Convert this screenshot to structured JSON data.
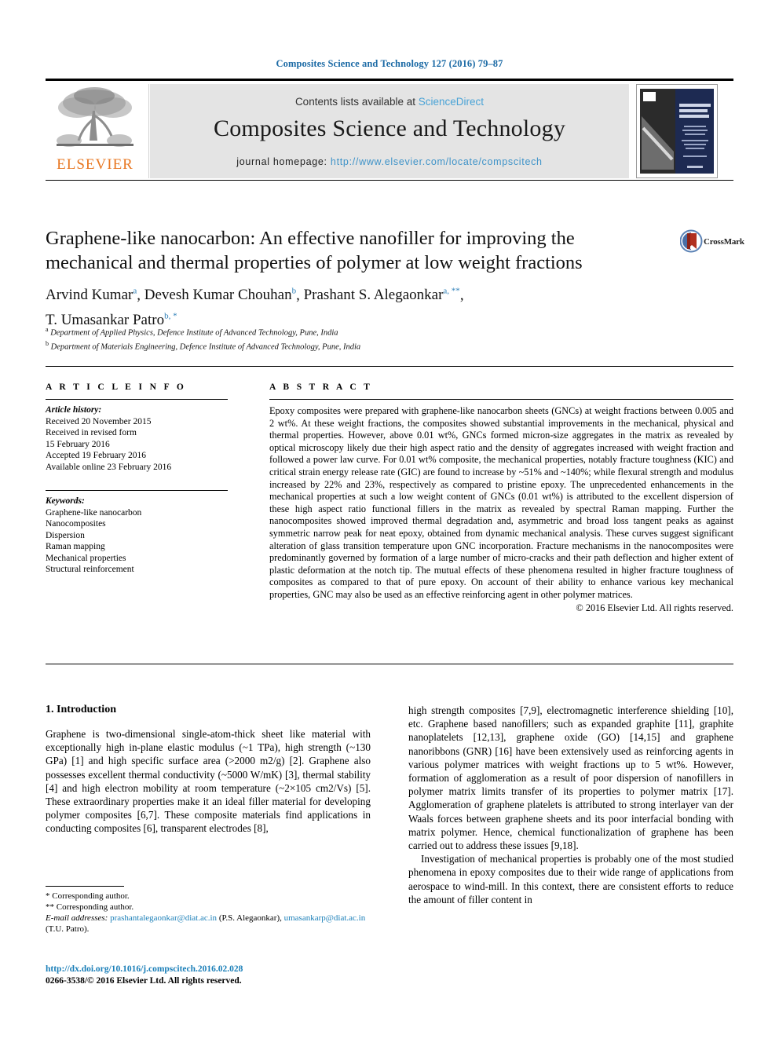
{
  "running_head": "Composites Science and Technology 127 (2016) 79–87",
  "masthead": {
    "publisher_name": "ELSEVIER",
    "contents_prefix": "Contents lists available at ",
    "contents_link": "ScienceDirect",
    "journal_title": "Composites Science and Technology",
    "homepage_label": "journal homepage:",
    "homepage_url": "http://www.elsevier.com/locate/compscitech",
    "cover_title": "COMPOSITES SCIENCE AND TECHNOLOGY"
  },
  "article": {
    "title": "Graphene-like nanocarbon: An effective nanofiller for improving the mechanical and thermal properties of polymer at low weight fractions",
    "crossmark_label": "CrossMark",
    "authors": [
      {
        "name": "Arvind Kumar",
        "marks": "a"
      },
      {
        "name": "Devesh Kumar Chouhan",
        "marks": "b"
      },
      {
        "name": "Prashant S. Alegaonkar",
        "marks": "a, **"
      },
      {
        "name": "T. Umasankar Patro",
        "marks": "b, *"
      }
    ],
    "affiliations": [
      {
        "mark": "a",
        "text": "Department of Applied Physics, Defence Institute of Advanced Technology, Pune, India"
      },
      {
        "mark": "b",
        "text": "Department of Materials Engineering, Defence Institute of Advanced Technology, Pune, India"
      }
    ]
  },
  "article_info": {
    "heading": "A R T I C L E   I N F O",
    "history_label": "Article history:",
    "history": [
      "Received 20 November 2015",
      "Received in revised form",
      "15 February 2016",
      "Accepted 19 February 2016",
      "Available online 23 February 2016"
    ],
    "keywords_label": "Keywords:",
    "keywords": [
      "Graphene-like nanocarbon",
      "Nanocomposites",
      "Dispersion",
      "Raman mapping",
      "Mechanical properties",
      "Structural reinforcement"
    ]
  },
  "abstract": {
    "heading": "A B S T R A C T",
    "text": "Epoxy composites were prepared with graphene-like nanocarbon sheets (GNCs) at weight fractions between 0.005 and 2 wt%. At these weight fractions, the composites showed substantial improvements in the mechanical, physical and thermal properties. However, above 0.01 wt%, GNCs formed micron-size aggregates in the matrix as revealed by optical microscopy likely due their high aspect ratio and the density of aggregates increased with weight fraction and followed a power law curve. For 0.01 wt% composite, the mechanical properties, notably fracture toughness (KIC) and critical strain energy release rate (GIC) are found to increase by ~51% and ~140%; while flexural strength and modulus increased by 22% and 23%, respectively as compared to pristine epoxy. The unprecedented enhancements in the mechanical properties at such a low weight content of GNCs (0.01 wt%) is attributed to the excellent dispersion of these high aspect ratio functional fillers in the matrix as revealed by spectral Raman mapping. Further the nanocomposites showed improved thermal degradation and, asymmetric and broad loss tangent peaks as against symmetric narrow peak for neat epoxy, obtained from dynamic mechanical analysis. These curves suggest significant alteration of glass transition temperature upon GNC incorporation. Fracture mechanisms in the nanocomposites were predominantly governed by formation of a large number of micro-cracks and their path deflection and higher extent of plastic deformation at the notch tip. The mutual effects of these phenomena resulted in higher fracture toughness of composites as compared to that of pure epoxy. On account of their ability to enhance various key mechanical properties, GNC may also be used as an effective reinforcing agent in other polymer matrices.",
    "copyright": "© 2016 Elsevier Ltd. All rights reserved."
  },
  "body": {
    "section_heading": "1. Introduction",
    "left_paragraph_1": "Graphene is two-dimensional single-atom-thick sheet like material with exceptionally high in-plane elastic modulus (~1 TPa), high strength (~130 GPa) [1] and high specific surface area (>2000 m2/g) [2]. Graphene also possesses excellent thermal conductivity (~5000 W/mK) [3], thermal stability [4] and high electron mobility at room temperature (~2×105 cm2/Vs) [5]. These extraordinary properties make it an ideal filler material for developing polymer composites [6,7]. These composite materials find applications in conducting composites [6], transparent electrodes [8],",
    "right_paragraph_1": "high strength composites [7,9], electromagnetic interference shielding [10], etc. Graphene based nanofillers; such as expanded graphite [11], graphite nanoplatelets [12,13], graphene oxide (GO) [14,15] and graphene nanoribbons (GNR) [16] have been extensively used as reinforcing agents in various polymer matrices with weight fractions up to 5 wt%. However, formation of agglomeration as a result of poor dispersion of nanofillers in polymer matrix limits transfer of its properties to polymer matrix [17]. Agglomeration of graphene platelets is attributed to strong interlayer van der Waals forces between graphene sheets and its poor interfacial bonding with matrix polymer. Hence, chemical functionalization of graphene has been carried out to address these issues [9,18].",
    "right_paragraph_2": "Investigation of mechanical properties is probably one of the most studied phenomena in epoxy composites due to their wide range of applications from aerospace to wind-mill. In this context, there are consistent efforts to reduce the amount of filler content in"
  },
  "footnotes": {
    "star": "* Corresponding author.",
    "doublestar": "** Corresponding author.",
    "email_label": "E-mail addresses:",
    "email_1": "prashantalegaonkar@diat.ac.in",
    "email_1_owner": "(P.S. Alegaonkar),",
    "email_2": "umasankarp@diat.ac.in",
    "email_2_owner": "(T.U. Patro)."
  },
  "footer": {
    "doi": "http://dx.doi.org/10.1016/j.compscitech.2016.02.028",
    "issn_line": "0266-3538/© 2016 Elsevier Ltd. All rights reserved."
  },
  "colors": {
    "link": "#1b7fb8",
    "elsevier_orange": "#e87722",
    "band": "#e4e4e4"
  }
}
